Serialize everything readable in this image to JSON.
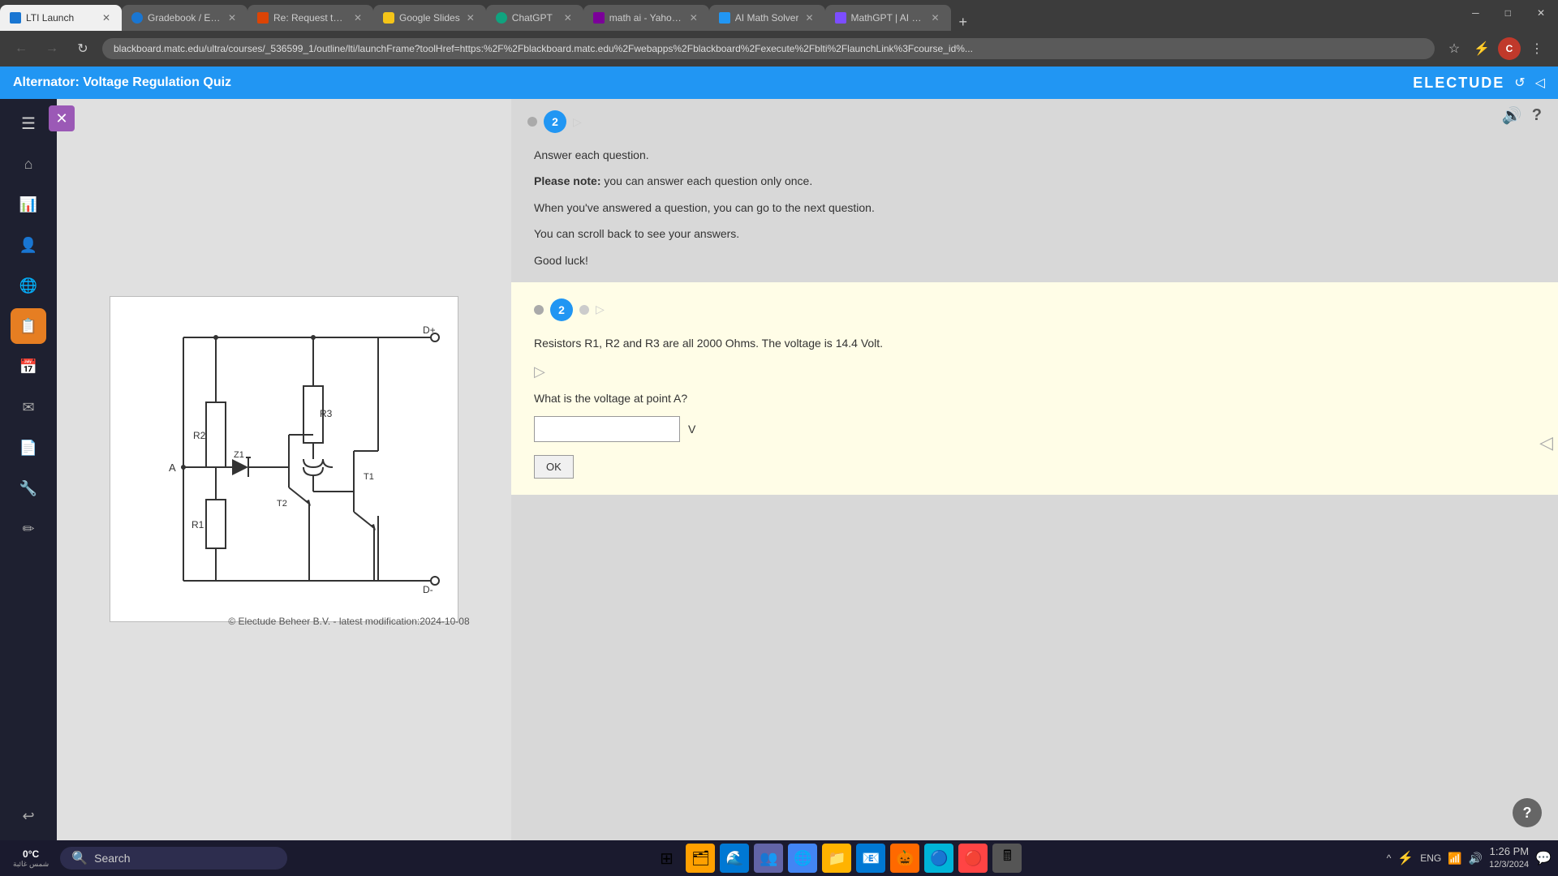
{
  "browser": {
    "tabs": [
      {
        "id": "lti",
        "label": "LTI Launch",
        "favicon": "lti",
        "active": true
      },
      {
        "id": "grade",
        "label": "Gradebook / Ele...",
        "favicon": "grade",
        "active": false
      },
      {
        "id": "mail",
        "label": "Re: Request to R...",
        "favicon": "mail",
        "active": false
      },
      {
        "id": "slides",
        "label": "Google Slides",
        "favicon": "slides",
        "active": false
      },
      {
        "id": "chatgpt",
        "label": "ChatGPT",
        "favicon": "chatgpt",
        "active": false
      },
      {
        "id": "yahoo",
        "label": "math ai - Yahoo...",
        "favicon": "yahoo",
        "active": false
      },
      {
        "id": "aimath",
        "label": "AI Math Solver",
        "favicon": "aimath",
        "active": false
      },
      {
        "id": "mathgpt",
        "label": "MathGPT | AI M...",
        "favicon": "mathgpt",
        "active": false
      }
    ],
    "address": "blackboard.matc.edu/ultra/courses/_536599_1/outline/lti/launchFrame?toolHref=https:%2F%2Fblackboard.matc.edu%2Fwebapps%2Fblackboard%2Fexecute%2Fblti%2FlaunchLink%3Fcourse_id%...",
    "window_controls": [
      "─",
      "□",
      "✕"
    ]
  },
  "app": {
    "title": "Alternator: Voltage Regulation Quiz",
    "brand": "ELECTUDE",
    "header_buttons": [
      "🔊",
      "?"
    ]
  },
  "sidebar": {
    "items": [
      {
        "icon": "☰",
        "label": "menu"
      },
      {
        "icon": "⌂",
        "label": "home"
      },
      {
        "icon": "📊",
        "label": "grades"
      },
      {
        "icon": "👤",
        "label": "profile"
      },
      {
        "icon": "🌐",
        "label": "global"
      },
      {
        "icon": "📋",
        "label": "list"
      },
      {
        "icon": "📅",
        "label": "calendar"
      },
      {
        "icon": "✉",
        "label": "messages"
      },
      {
        "icon": "📄",
        "label": "documents"
      },
      {
        "icon": "🔧",
        "label": "tools"
      },
      {
        "icon": "✏",
        "label": "edit"
      },
      {
        "icon": "↩",
        "label": "back"
      }
    ]
  },
  "quiz": {
    "question_number": "2",
    "instructions": {
      "answer_each": "Answer each question.",
      "note_label": "Please note:",
      "note_text": " you can answer each question only once.",
      "next_info": "When you've answered a question, you can go to the next question.",
      "scroll_info": "You can scroll back to see your answers.",
      "good_luck": "Good luck!"
    },
    "question": {
      "setup": "Resistors R1, R2 and R3 are all 2000 Ohms. The voltage is 14.4 Volt.",
      "prompt": "What is the voltage at point A?",
      "answer_placeholder": "",
      "unit": "V",
      "ok_label": "OK"
    }
  },
  "circuit": {
    "labels": [
      "R2",
      "R3",
      "Z1",
      "T2",
      "T1",
      "R1",
      "D+",
      "D-",
      "A"
    ]
  },
  "copyright": "© Electude Beheer B.V. - latest modification:2024-10-08",
  "taskbar": {
    "weather": {
      "temp": "0°C",
      "location": "شمس غائبة"
    },
    "search_placeholder": "Search",
    "time": "1:26 PM",
    "date": "12/3/2024",
    "lang": "ENG"
  }
}
